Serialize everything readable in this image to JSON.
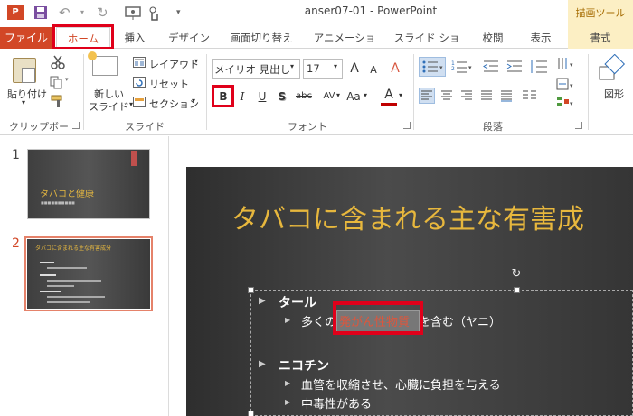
{
  "title_bar": {
    "app_logo": "P",
    "window_title": "anser07-01 - PowerPoint",
    "contextual_tab_label": "描画ツール",
    "icons": [
      "save-icon",
      "undo-icon",
      "redo-icon",
      "present-icon",
      "touch-mode-icon",
      "qat-customize-icon"
    ]
  },
  "tabs": [
    {
      "label": "ファイル"
    },
    {
      "label": "ホーム",
      "selected": true
    },
    {
      "label": "挿入"
    },
    {
      "label": "デザイン"
    },
    {
      "label": "画面切り替え"
    },
    {
      "label": "アニメーション"
    },
    {
      "label": "スライド ショー"
    },
    {
      "label": "校閲"
    },
    {
      "label": "表示"
    },
    {
      "label": "書式"
    }
  ],
  "ribbon": {
    "clipboard": {
      "group_label": "クリップボード",
      "paste_label": "貼り付け",
      "paste_arrow": "▾"
    },
    "slides": {
      "group_label": "スライド",
      "new_slide_label_1": "新しい",
      "new_slide_label_2": "スライド",
      "new_slide_arrow": "▾",
      "layout_label": "レイアウト",
      "reset_label": "リセット",
      "section_label": "セクション",
      "dropdown_arrow": "▾"
    },
    "font": {
      "group_label": "フォント",
      "font_name": "メイリオ 見出し",
      "font_size": "17",
      "bold": "B",
      "italic": "I",
      "underline": "U",
      "shadow": "S",
      "strikethrough": "abc",
      "spacing": "AV",
      "change_case": "Aa",
      "font_color": "A",
      "grow_font": "A",
      "shrink_font": "A",
      "clear_format": "A",
      "accent_color": "#c00000"
    },
    "paragraph": {
      "group_label": "段落"
    },
    "drawing": {
      "shape_label": "図形"
    }
  },
  "thumbnails": [
    {
      "number": "1",
      "title": "タバコと健康",
      "subtitle": "■■■■■■■■■■"
    },
    {
      "number": "2",
      "title": "タバコに含まれる主な有害成分",
      "selected": true
    }
  ],
  "slide": {
    "title": "タバコに含まれる主な有害成",
    "bullet_glyph": "▶",
    "sub_bullet_glyph": "▶",
    "items": [
      {
        "heading": "タール",
        "sub_before": "多くの",
        "sub_selected": "発がん性物質",
        "sub_after": "を含む（ヤニ）"
      },
      {
        "heading": "ニコチン",
        "subs": [
          "血管を収縮させ、心臓に負担を与える",
          "中毒性がある"
        ]
      }
    ],
    "rotate_glyph": "↻"
  },
  "colors": {
    "brand": "#d24726",
    "title_text": "#e7b73d",
    "highlight": "#e0001a",
    "contextual_tab": "#fcefc4"
  }
}
